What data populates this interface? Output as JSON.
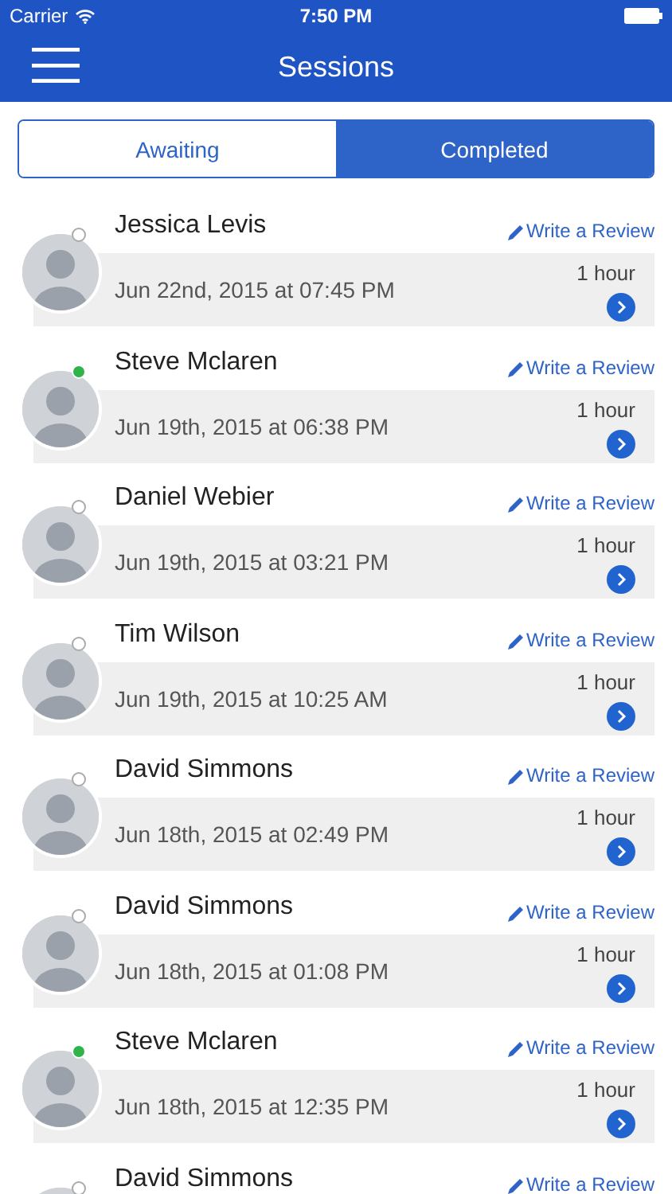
{
  "status_bar": {
    "carrier": "Carrier",
    "time": "7:50 PM"
  },
  "nav": {
    "title": "Sessions"
  },
  "tabs": [
    {
      "label": "Awaiting",
      "selected": false
    },
    {
      "label": "Completed",
      "selected": true
    }
  ],
  "sessions": [
    {
      "name": "Jessica Levis",
      "online": false,
      "action": "Write a Review",
      "date": "Jun 22nd, 2015 at 07:45 PM",
      "duration": "1 hour"
    },
    {
      "name": "Steve Mclaren",
      "online": true,
      "action": "Write a Review",
      "date": "Jun 19th, 2015 at 06:38 PM",
      "duration": "1 hour"
    },
    {
      "name": "Daniel Webier",
      "online": false,
      "action": "Write a Review",
      "date": "Jun 19th, 2015 at 03:21 PM",
      "duration": "1 hour"
    },
    {
      "name": "Tim Wilson",
      "online": false,
      "action": "Write a Review",
      "date": "Jun 19th, 2015 at 10:25 AM",
      "duration": "1 hour"
    },
    {
      "name": "David Simmons",
      "online": false,
      "action": "Write a Review",
      "date": "Jun 18th, 2015 at 02:49 PM",
      "duration": "1 hour"
    },
    {
      "name": "David Simmons",
      "online": false,
      "action": "Write a Review",
      "date": "Jun 18th, 2015 at 01:08 PM",
      "duration": "1 hour"
    },
    {
      "name": "Steve Mclaren",
      "online": true,
      "action": "Write a Review",
      "date": "Jun 18th, 2015 at 12:35 PM",
      "duration": "1 hour"
    },
    {
      "name": "David Simmons",
      "online": false,
      "action": "Write a Review"
    }
  ]
}
